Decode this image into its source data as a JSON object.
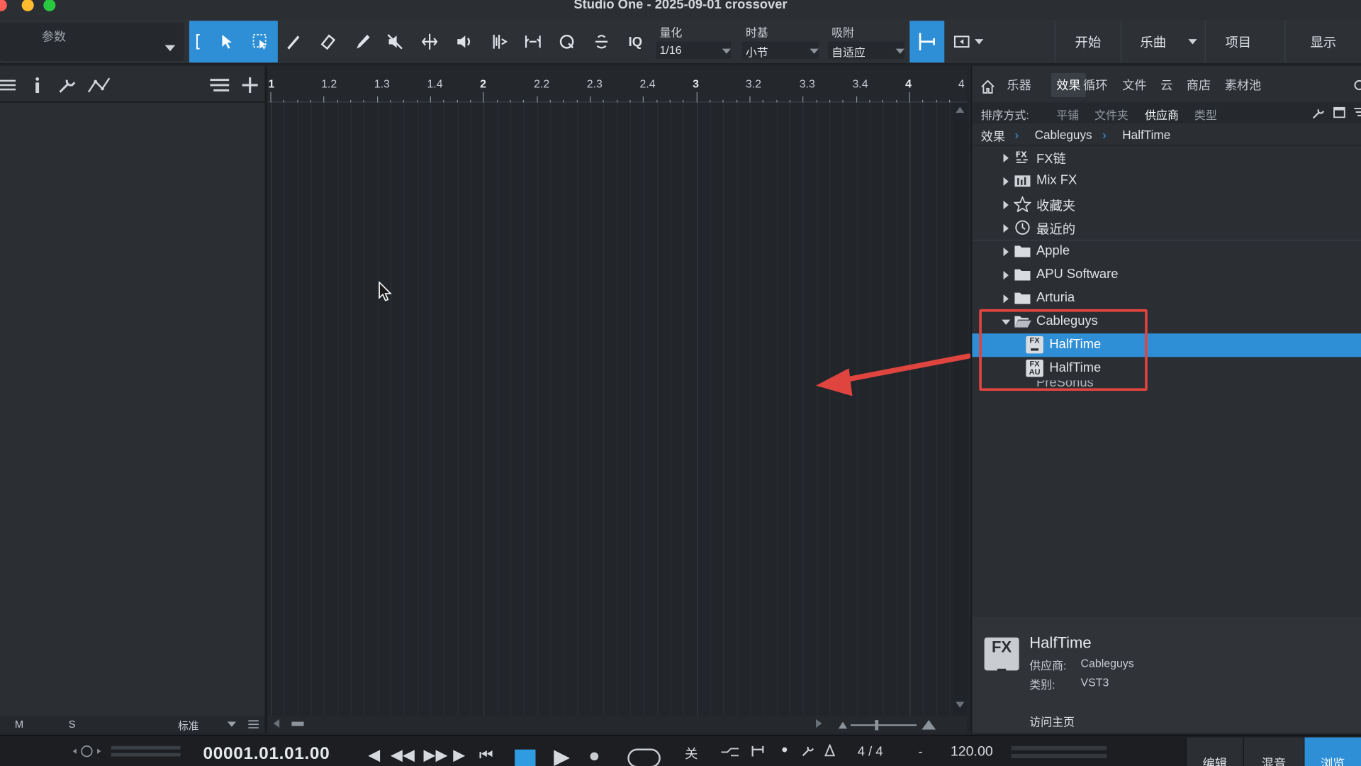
{
  "window": {
    "title": "Studio One - 2025-09-01 crossover"
  },
  "toolbar": {
    "param_label": "参数",
    "iq_label": "IQ",
    "quantize": {
      "label": "量化",
      "value": "1/16"
    },
    "timebase": {
      "label": "时基",
      "value": "小节"
    },
    "snap": {
      "label": "吸附",
      "value": "自适应"
    },
    "nav": [
      "开始",
      "乐曲",
      "项目",
      "显示"
    ]
  },
  "ruler": {
    "labels": [
      "1",
      "1.2",
      "1.3",
      "1.4",
      "2",
      "2.2",
      "2.3",
      "2.4",
      "3",
      "3.2",
      "3.3",
      "3.4",
      "4",
      "4"
    ]
  },
  "left_footer": {
    "m": "M",
    "s": "S",
    "mode": "标准"
  },
  "browser": {
    "tabs": [
      "乐器",
      "效果",
      "循环",
      "文件",
      "云",
      "商店",
      "素材池"
    ],
    "active_tab": "效果",
    "sort": {
      "label": "排序方式:",
      "options": [
        "平铺",
        "文件夹",
        "供应商",
        "类型"
      ],
      "active": "供应商"
    },
    "breadcrumb": [
      "效果",
      "Cableguys",
      "HalfTime"
    ],
    "tree": [
      {
        "label": "FX链",
        "icon": "fx-chain-icon"
      },
      {
        "label": "Mix FX",
        "icon": "mixfx-icon"
      },
      {
        "label": "收藏夹",
        "icon": "star-icon"
      },
      {
        "label": "最近的",
        "icon": "clock-icon"
      },
      {
        "label": "Apple",
        "icon": "folder-icon"
      },
      {
        "label": "APU Software",
        "icon": "folder-icon"
      },
      {
        "label": "Arturia",
        "icon": "folder-icon"
      },
      {
        "label": "Cableguys",
        "icon": "folder-open-icon"
      },
      {
        "label": "HalfTime",
        "icon": "fx-vst3-icon"
      },
      {
        "label": "HalfTime",
        "icon": "fx-au-icon"
      },
      {
        "label": "PreSonus",
        "icon": "presonus-icon"
      }
    ],
    "info": {
      "name": "HalfTime",
      "vendor_label": "供应商:",
      "vendor": "Cableguys",
      "type_label": "类别:",
      "type": "VST3",
      "homepage": "访问主页",
      "fx_badge": "FX"
    }
  },
  "transport": {
    "timecode": "00001.01.01.00",
    "off": "关",
    "meter": "4 / 4",
    "dash": "-",
    "tempo": "120.00",
    "tabs": [
      "编辑",
      "混音",
      "浏览"
    ],
    "active_tab": "浏览"
  },
  "colors": {
    "accent": "#2f8fd6",
    "highlight": "#e0443f",
    "bg": "#22262b"
  }
}
